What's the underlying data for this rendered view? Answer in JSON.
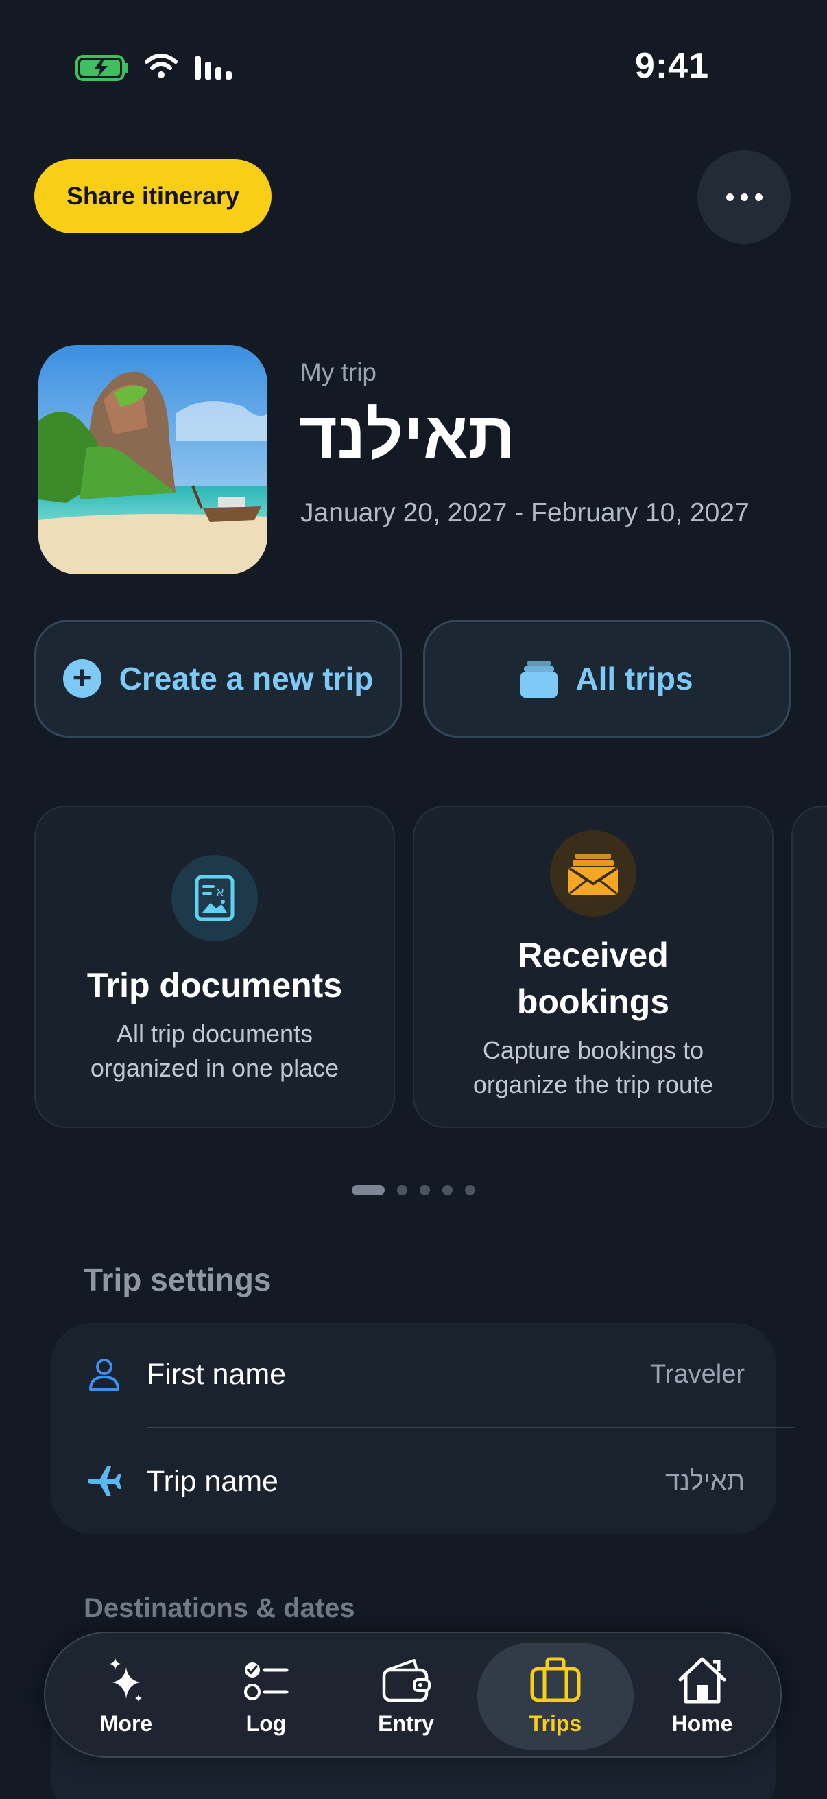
{
  "status_bar": {
    "time": "9:41"
  },
  "header": {
    "share_label": "Share itinerary"
  },
  "trip": {
    "label": "My trip",
    "title": "תאילנד",
    "dates": "January 20, 2027 - February 10, 2027"
  },
  "actions": {
    "new_trip": "Create a new trip",
    "all_trips": "All trips"
  },
  "cards": [
    {
      "title": "Trip documents",
      "desc": "All trip documents organized in one place",
      "icon": "document-icon"
    },
    {
      "title": "Received bookings",
      "desc": "Capture bookings to organize the trip route",
      "icon": "envelope-icon"
    }
  ],
  "pager": {
    "count": 5,
    "active": 0
  },
  "settings": {
    "title": "Trip settings",
    "rows": [
      {
        "label": "First name",
        "value": "Traveler",
        "icon": "person-icon"
      },
      {
        "label": "Trip name",
        "value": "תאילנד",
        "icon": "airplane-icon"
      }
    ]
  },
  "destinations": {
    "title": "Destinations & dates"
  },
  "tabs": [
    {
      "label": "More",
      "icon": "sparkles-icon"
    },
    {
      "label": "Log",
      "icon": "checklist-icon"
    },
    {
      "label": "Entry",
      "icon": "wallet-icon"
    },
    {
      "label": "Trips",
      "icon": "suitcase-icon",
      "active": true
    },
    {
      "label": "Home",
      "icon": "home-icon"
    }
  ],
  "colors": {
    "accent_yellow": "#f8cf16",
    "accent_blue": "#7ec9f5",
    "background": "#131a24"
  }
}
